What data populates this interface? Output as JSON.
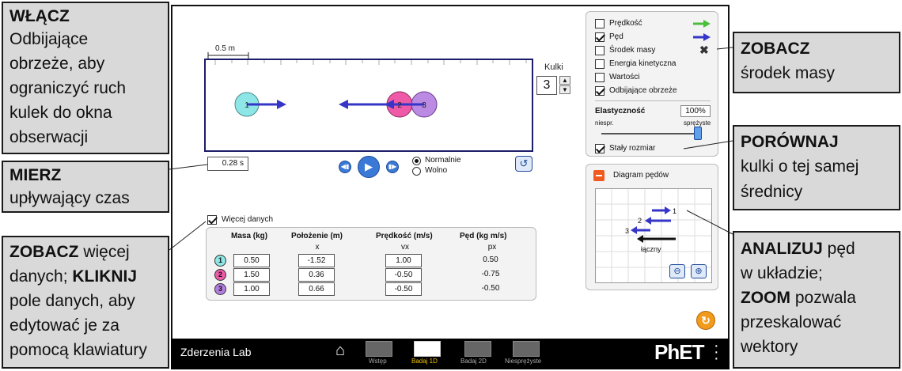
{
  "callouts": {
    "wlacz": {
      "title": "WŁĄCZ",
      "lines": [
        "Odbijające",
        "obrzeże, aby",
        "ograniczyć ruch",
        "kulek do okna",
        "obserwacji"
      ]
    },
    "mierz": {
      "title": "MIERZ",
      "lines": [
        "upływający czas"
      ]
    },
    "zobacz_wiecej": {
      "title1": "ZOBACZ",
      "rest1": " więcej",
      "line2a": "danych; ",
      "title2": "KLIKNIJ",
      "lines": [
        "pole danych, aby",
        "edytować je za",
        "pomocą klawiatury"
      ]
    },
    "zobacz_srodek": {
      "title": "ZOBACZ",
      "lines": [
        "środek masy"
      ]
    },
    "porownaj": {
      "title": "PORÓWNAJ",
      "lines": [
        "kulki o tej samej",
        "średnicy"
      ]
    },
    "analizuj": {
      "title1": "ANALIZUJ",
      "rest1": " pęd",
      "line2": "w układzie;",
      "title2": "ZOOM",
      "rest2": " pozwala",
      "lines": [
        "przeskalować",
        "wektory"
      ]
    }
  },
  "play_area": {
    "scale_label": "0.5 m",
    "balls_label": "Kulki",
    "balls_count": "3",
    "ball_numbers": [
      "1",
      "2",
      "3"
    ],
    "time_value": "0.28 s",
    "speed_options": [
      "Normalnie",
      "Wolno"
    ],
    "speed_selected": "Normalnie"
  },
  "controls": {
    "checkboxes": [
      {
        "label": "Prędkość",
        "checked": false
      },
      {
        "label": "Pęd",
        "checked": true
      },
      {
        "label": "Środek masy",
        "checked": false
      },
      {
        "label": "Energia kinetyczna",
        "checked": false
      },
      {
        "label": "Wartości",
        "checked": false
      },
      {
        "label": "Odbijające obrzeże",
        "checked": true
      }
    ],
    "elasticity_label": "Elastyczność",
    "elasticity_value": "100%",
    "elasticity_fraction": 1.0,
    "slider_min_label": "niespr.",
    "slider_max_label": "sprężyste",
    "constant_size_label": "Stały rozmiar",
    "constant_size_checked": true
  },
  "momenta_diagram": {
    "title": "Diagram pędów",
    "labels": [
      "1",
      "2",
      "3"
    ],
    "total_label": "łączny"
  },
  "data_table": {
    "toggle_label": "Więcej danych",
    "toggle_checked": true,
    "headers": [
      "Masa (kg)",
      "Położenie (m)",
      "Prędkość (m/s)",
      "Pęd (kg m/s)"
    ],
    "subheaders": [
      "x",
      "vx",
      "px"
    ],
    "rows": [
      {
        "ball": "1",
        "mass": "0.50",
        "position": "-1.52",
        "velocity": "1.00",
        "momentum": "0.50"
      },
      {
        "ball": "2",
        "mass": "1.50",
        "position": "0.36",
        "velocity": "-0.50",
        "momentum": "-0.75"
      },
      {
        "ball": "3",
        "mass": "1.00",
        "position": "0.66",
        "velocity": "-0.50",
        "momentum": "-0.50"
      }
    ]
  },
  "navbar": {
    "app_title": "Zderzenia Lab",
    "screens": [
      {
        "label": "Wstęp",
        "active": false
      },
      {
        "label": "Badaj 1D",
        "active": true
      },
      {
        "label": "Badaj 2D",
        "active": false
      },
      {
        "label": "Niesprężyste",
        "active": false
      }
    ],
    "brand": "PhET"
  },
  "colors": {
    "ball1": "#8ee6e6",
    "ball2": "#ee5aa8",
    "ball3": "#b47ee0",
    "arrow": "#3535c8",
    "velocity_arrow": "#4bbf3b",
    "reset_orange": "#f29a1c",
    "play_blue": "#3a7ad6"
  }
}
